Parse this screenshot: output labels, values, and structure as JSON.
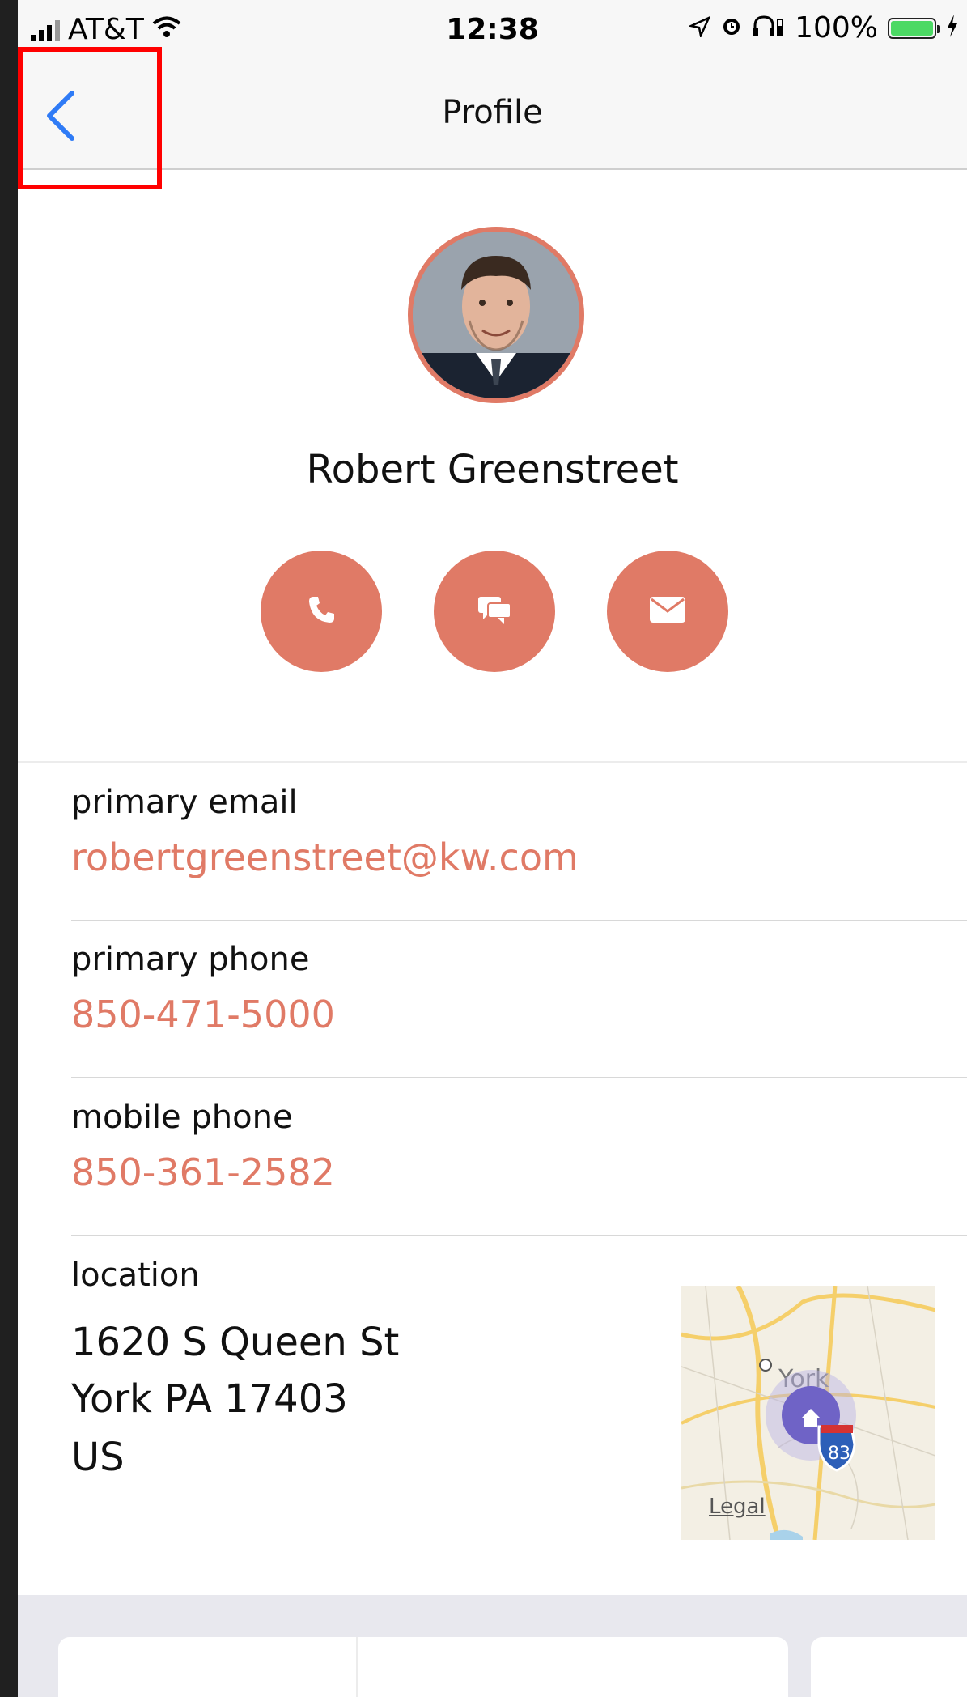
{
  "status_bar": {
    "carrier": "AT&T",
    "time": "12:38",
    "battery": "100%"
  },
  "navbar": {
    "title": "Profile"
  },
  "profile": {
    "name": "Robert Greenstreet"
  },
  "fields": [
    {
      "label": "primary email",
      "value": "robertgreenstreet@kw.com"
    },
    {
      "label": "primary phone",
      "value": "850-471-5000"
    },
    {
      "label": "mobile phone",
      "value": "850-361-2582"
    }
  ],
  "location": {
    "label": "location",
    "line1": "1620 S Queen St",
    "line2": "York PA 17403",
    "line3": "US"
  },
  "map": {
    "legal": "Legal",
    "city": "York",
    "route": "83"
  },
  "colors": {
    "accent": "#e07a66",
    "ios_blue": "#2f7bf6"
  }
}
